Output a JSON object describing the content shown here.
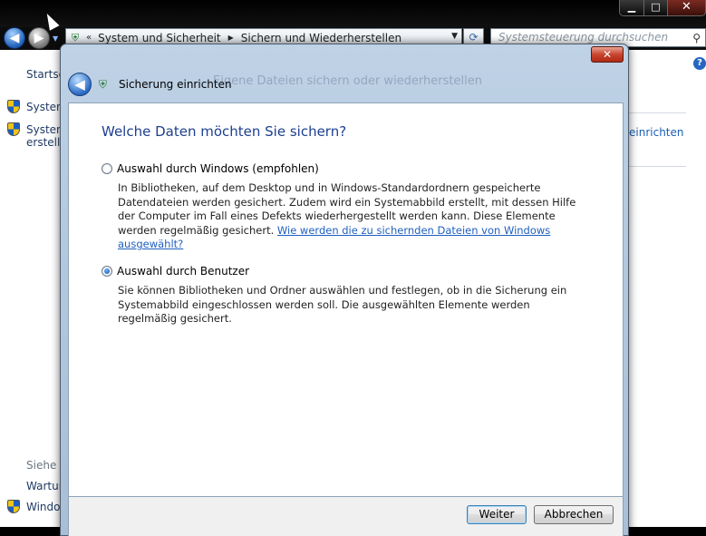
{
  "window": {
    "controls": {
      "minimize": "▁",
      "maximize": "□",
      "close": "✕"
    }
  },
  "addressbar": {
    "chevron": "«",
    "crumbs": [
      "System und Sicherheit",
      "Sichern und Wiederherstellen"
    ],
    "separator": "▶",
    "dropdown": "▼"
  },
  "search": {
    "placeholder": "Systemsteuerung durchsuchen"
  },
  "sidebar": {
    "items": [
      "Startse",
      "System",
      "System",
      "erstelle"
    ],
    "see_also": "Siehe a",
    "bottom_items": [
      "Wartur",
      "Windo"
    ]
  },
  "right_panel": {
    "link": "einrichten"
  },
  "dialog": {
    "title": "Sicherung einrichten",
    "ghost_text": "Eigene Dateien sichern oder wiederherstellen",
    "heading": "Welche Daten möchten Sie sichern?",
    "options": [
      {
        "label": "Auswahl durch Windows (empfohlen)",
        "checked": false,
        "description": "In Bibliotheken, auf dem Desktop und in Windows-Standardordnern gespeicherte Datendateien werden gesichert. Zudem wird ein Systemabbild erstellt, mit dessen Hilfe der Computer im Fall eines Defekts wiederhergestellt werden kann. Diese Elemente werden regelmäßig gesichert.",
        "link": "Wie werden die zu sichernden Dateien von Windows ausgewählt?"
      },
      {
        "label": "Auswahl durch Benutzer",
        "checked": true,
        "description": "Sie können Bibliotheken und Ordner auswählen und festlegen, ob in die Sicherung ein Systemabbild eingeschlossen werden soll. Die ausgewählten Elemente werden regelmäßig gesichert."
      }
    ],
    "buttons": {
      "next": "Weiter",
      "cancel": "Abbrechen"
    },
    "close_glyph": "✕"
  },
  "colors": {
    "heading": "#1e3f8f",
    "link": "#1f5fbf",
    "dialog_frame": "#b4c8de"
  }
}
